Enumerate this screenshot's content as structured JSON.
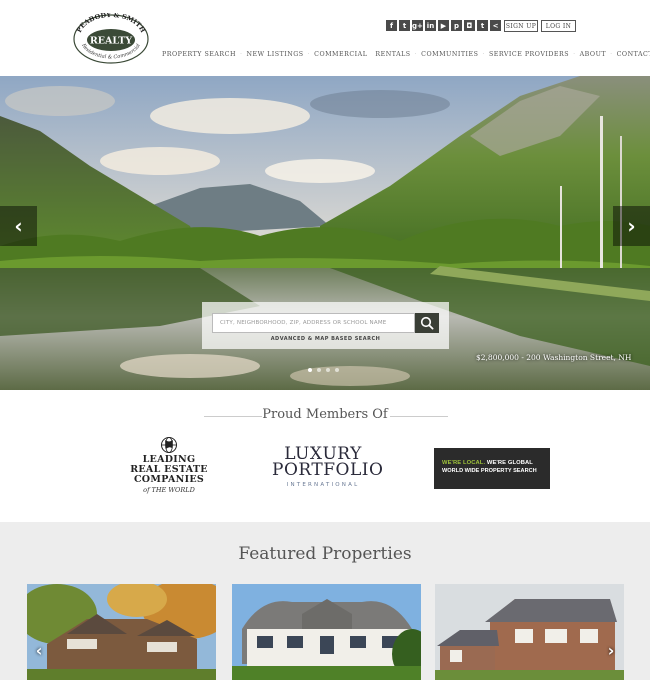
{
  "brand": {
    "name_top": "PEABODY & SMITH",
    "name_main": "REALTY",
    "name_bottom": "Residential & Commercial"
  },
  "social_icons": [
    "facebook-icon",
    "twitter-icon",
    "google-plus-icon",
    "linkedin-icon",
    "youtube-icon",
    "pinterest-icon",
    "instagram-icon",
    "tumblr-icon",
    "share-icon"
  ],
  "social_glyphs": [
    "f",
    "t",
    "g+",
    "in",
    "▶",
    "p",
    "◘",
    "t",
    "<"
  ],
  "auth": {
    "signup": "SIGN UP",
    "login": "LOG IN"
  },
  "nav": {
    "items": [
      "PROPERTY SEARCH",
      "NEW LISTINGS",
      "COMMERCIAL",
      "RENTALS",
      "COMMUNITIES",
      "SERVICE PROVIDERS",
      "ABOUT",
      "CONTACT"
    ]
  },
  "hero": {
    "prev": "‹",
    "next": "›",
    "search_placeholder": "CITY, NEIGHBORHOOD, ZIP, ADDRESS OR SCHOOL NAME",
    "advanced_label": "ADVANCED & MAP BASED SEARCH",
    "caption": "$2,800,000 - 200 Washington Street, NH",
    "slide_count": 4,
    "active_slide": 1
  },
  "members": {
    "title": "Proud Members Of",
    "lre": {
      "line1": "LEADING",
      "line2": "REAL ESTATE",
      "line3": "COMPANIES",
      "sub": "of THE WORLD"
    },
    "luxury": {
      "line1": "LUXURY",
      "line2": "PORTFOLIO",
      "line3": "INTERNATIONAL"
    },
    "wlg": {
      "green": "WE'RE LOCAL.",
      "white": "WE'RE GLOBAL",
      "line2": "WORLD WIDE PROPERTY SEARCH"
    }
  },
  "featured": {
    "title": "Featured Properties",
    "prev": "‹",
    "next": "›"
  },
  "colors": {
    "logo_green": "#3b4a37",
    "search_button": "#3a3f36",
    "wlg_green": "#9dc13b",
    "featured_bg": "#ededed"
  }
}
